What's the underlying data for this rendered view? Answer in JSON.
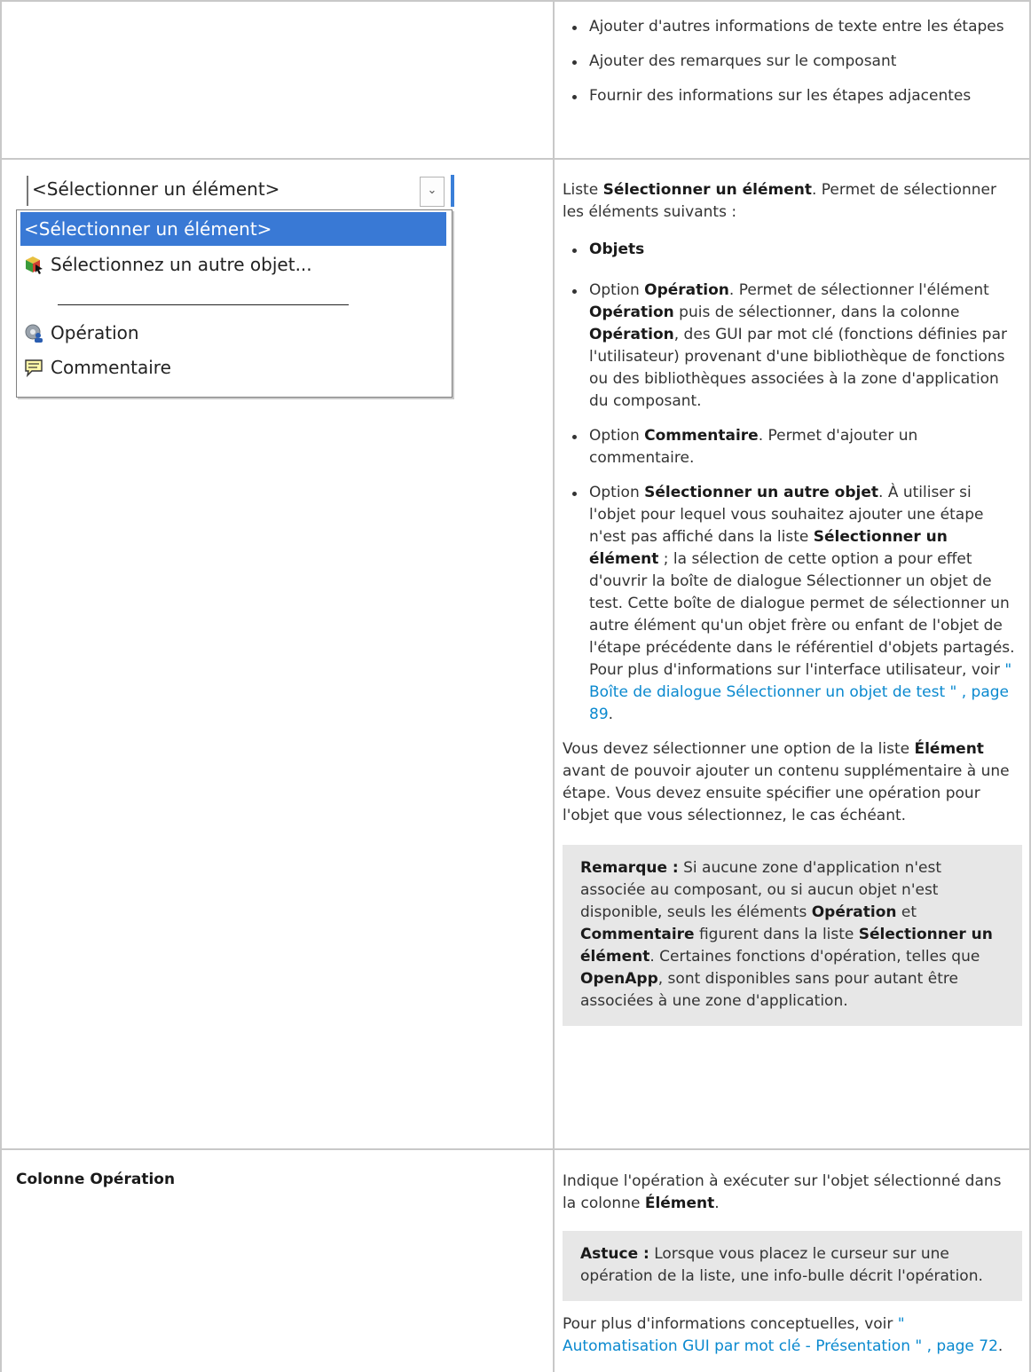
{
  "top_row": {
    "bullets": [
      "Ajouter d'autres informations de texte entre les étapes",
      "Ajouter des remarques sur le composant",
      "Fournir des informations sur les étapes adjacentes"
    ]
  },
  "dropdown": {
    "combo_value": "<Sélectionner un élément>",
    "items": [
      {
        "label": "<Sélectionner un élément>",
        "icon": "none",
        "selected": true
      },
      {
        "label": "Sélectionnez un autre objet...",
        "icon": "select-object-icon"
      },
      {
        "label": "Opération",
        "icon": "operation-icon"
      },
      {
        "label": "Commentaire",
        "icon": "comment-icon"
      }
    ],
    "colors": {
      "selection": "#3979d5",
      "accent_bar": "#3a7fd8"
    }
  },
  "item_row": {
    "intro_a": "Liste ",
    "intro_b": "Sélectionner un élément",
    "intro_c": ". Permet de sélectionner les éléments suivants :",
    "b1": "Objets",
    "b2_a": "Option ",
    "b2_b": "Opération",
    "b2_c": ". Permet de sélectionner l'élément ",
    "b2_d": "Opération",
    "b2_e": " puis de sélectionner, dans la colonne ",
    "b2_f": "Opération",
    "b2_g": ", des GUI par mot clé (fonctions définies par l'utilisateur) provenant d'une bibliothèque de fonctions ou des bibliothèques associées à la zone d'application du composant.",
    "b3_a": "Option ",
    "b3_b": "Commentaire",
    "b3_c": ". Permet d'ajouter un commentaire.",
    "b4_a": "Option ",
    "b4_b": "Sélectionner un autre objet",
    "b4_c": ". À utiliser si l'objet pour lequel vous souhaitez ajouter une étape n'est pas affiché dans la liste ",
    "b4_d": "Sélectionner un élément",
    "b4_e": " ; la sélection de cette option a pour effet d'ouvrir la boîte de dialogue Sélectionner un objet de test. Cette boîte de dialogue permet de sélectionner un autre élément qu'un objet frère ou enfant de l'objet de l'étape précédente dans le référentiel d'objets partagés. Pour plus d'informations sur l'interface utilisateur, voir ",
    "b4_link": "\" Boîte de dialogue Sélectionner un objet de test \" , page 89",
    "b4_end": ".",
    "p2_a": "Vous devez sélectionner une option de la liste ",
    "p2_b": "Élément",
    "p2_c": " avant de pouvoir ajouter un contenu supplémentaire à une étape. Vous devez ensuite spécifier une opération pour l'objet que vous sélectionnez, le cas échéant.",
    "note_label": "Remarque :",
    "note_a": " Si aucune zone d'application n'est associée au composant, ou si aucun objet n'est disponible, seuls les éléments ",
    "note_b": "Opération",
    "note_c": " et ",
    "note_d": "Commentaire",
    "note_e": " figurent dans la liste ",
    "note_f": "Sélectionner un élément",
    "note_g": ". Certaines fonctions d'opération, telles que ",
    "note_h": "OpenApp",
    "note_i": ", sont disponibles sans pour autant être associées à une zone d'application."
  },
  "operation_row": {
    "left_label": "Colonne Opération",
    "p1_a": "Indique l'opération à exécuter sur l'objet sélectionné dans la colonne ",
    "p1_b": "Élément",
    "p1_c": ".",
    "tip_label": "Astuce :",
    "tip_text": " Lorsque vous placez le curseur sur une opération de la liste, une info-bulle décrit l'opération.",
    "p2_a": "Pour plus d'informations conceptuelles, voir ",
    "p2_link": "\" Automatisation GUI par mot clé - Présentation \" , page 72",
    "p2_end": "."
  }
}
